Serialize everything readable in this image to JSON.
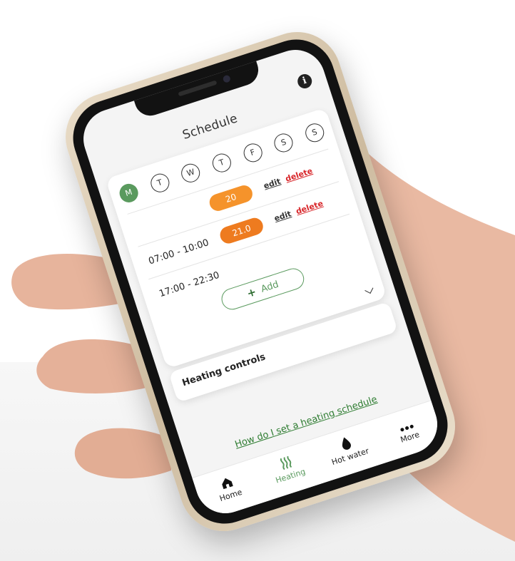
{
  "screen": {
    "title": "Schedule",
    "days": [
      "M",
      "T",
      "W",
      "T",
      "F",
      "S",
      "S"
    ],
    "active_day": "M",
    "schedule": [
      {
        "time": "",
        "temp": "20",
        "edit": "edit",
        "delete": "delete"
      },
      {
        "time": "07:00 - 10:00",
        "temp": "21.0",
        "edit": "edit",
        "delete": "delete"
      },
      {
        "time": "17:00 - 22:30",
        "temp": "",
        "edit": "",
        "delete": ""
      }
    ],
    "add_label": "Add",
    "heating_controls": "Heating controls",
    "help_link": "How do I set a heating schedule"
  },
  "tabbar": {
    "tabs": [
      {
        "label": "Home",
        "icon": "home-icon"
      },
      {
        "label": "Heating",
        "icon": "heating-icon",
        "active": true
      },
      {
        "label": "Hot water",
        "icon": "water-drop-icon"
      },
      {
        "label": "More",
        "icon": "more-dots-icon"
      }
    ]
  },
  "colors": {
    "accent_green": "#5a9a5e",
    "pill_orange": "#f5932b",
    "delete_red": "#d8272b",
    "link_green": "#2f7d32"
  }
}
